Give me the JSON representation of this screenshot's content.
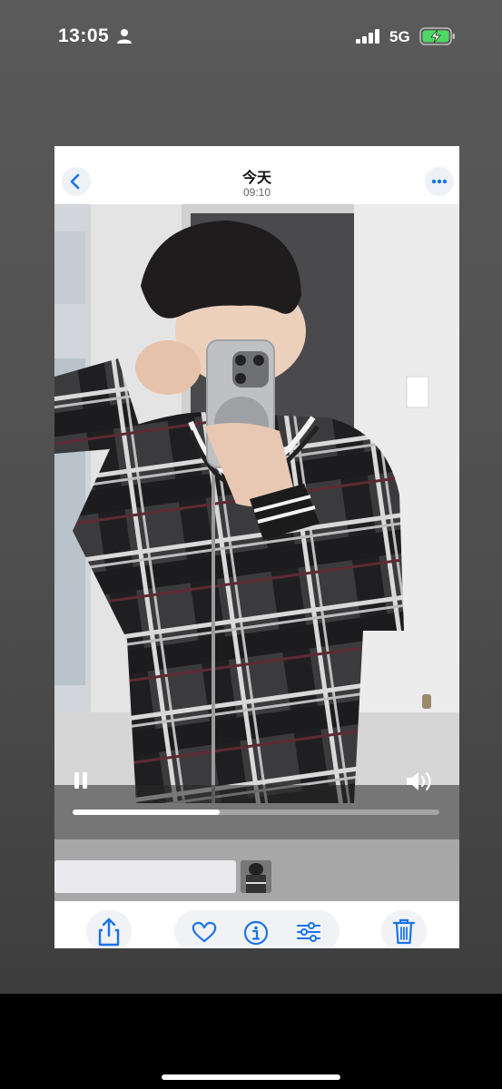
{
  "status_bar": {
    "time": "13:05",
    "network": "5G",
    "person_icon": "person-icon",
    "signal_icon": "signal-bars-icon",
    "battery_icon": "battery-charging-icon",
    "battery_color": "#4cd964"
  },
  "nav": {
    "title": "今天",
    "subtitle": "09:10",
    "back_icon": "chevron-left-icon",
    "more_icon": "ellipsis-icon",
    "accent": "#1a73e8"
  },
  "video": {
    "progress": 0.4
  },
  "toolbar": {
    "items": [
      "share-icon",
      "heart-icon",
      "info-icon",
      "sliders-icon",
      "trash-icon"
    ]
  }
}
